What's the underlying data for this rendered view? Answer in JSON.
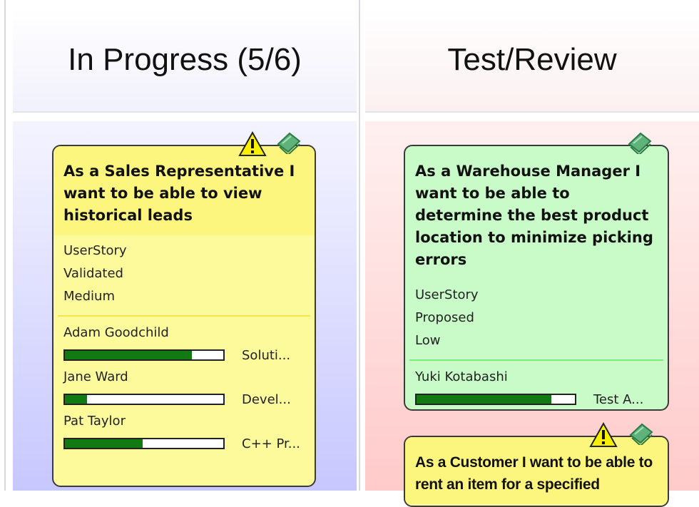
{
  "columns": [
    {
      "title": "In Progress (5/6)",
      "cards": [
        {
          "title": "As a Sales Representative I want to be able to view historical leads",
          "props": [
            "UserStory",
            "Validated",
            "Medium"
          ],
          "icons": [
            "warning-icon",
            "book-icon"
          ],
          "resources": [
            {
              "name": "Adam Goodchild",
              "role": "Soluti...",
              "progress": 0.8
            },
            {
              "name": "Jane Ward",
              "role": "Devel...",
              "progress": 0.14
            },
            {
              "name": "Pat Taylor",
              "role": "C++ Pr...",
              "progress": 0.49
            }
          ]
        }
      ]
    },
    {
      "title": "Test/Review",
      "cards": [
        {
          "title": "As a Warehouse Manager I want to be able to determine the best product location to minimize picking errors",
          "props": [
            "UserStory",
            "Proposed",
            "Low"
          ],
          "icons": [
            "book-icon"
          ],
          "resources": [
            {
              "name": "Yuki Kotabashi",
              "role": "Test A...",
              "progress": 0.85
            }
          ]
        },
        {
          "title": "As a Customer I want to be able to rent an item for a specified",
          "icons": [
            "warning-icon",
            "book-icon"
          ]
        }
      ]
    }
  ],
  "colors": {
    "yellow_card": "#fdfa9c",
    "green_card": "#c8fbc8",
    "progress_fill": "#137a13",
    "in_progress_bg": "#c7c7ff",
    "test_review_bg": "#ffcaca"
  }
}
